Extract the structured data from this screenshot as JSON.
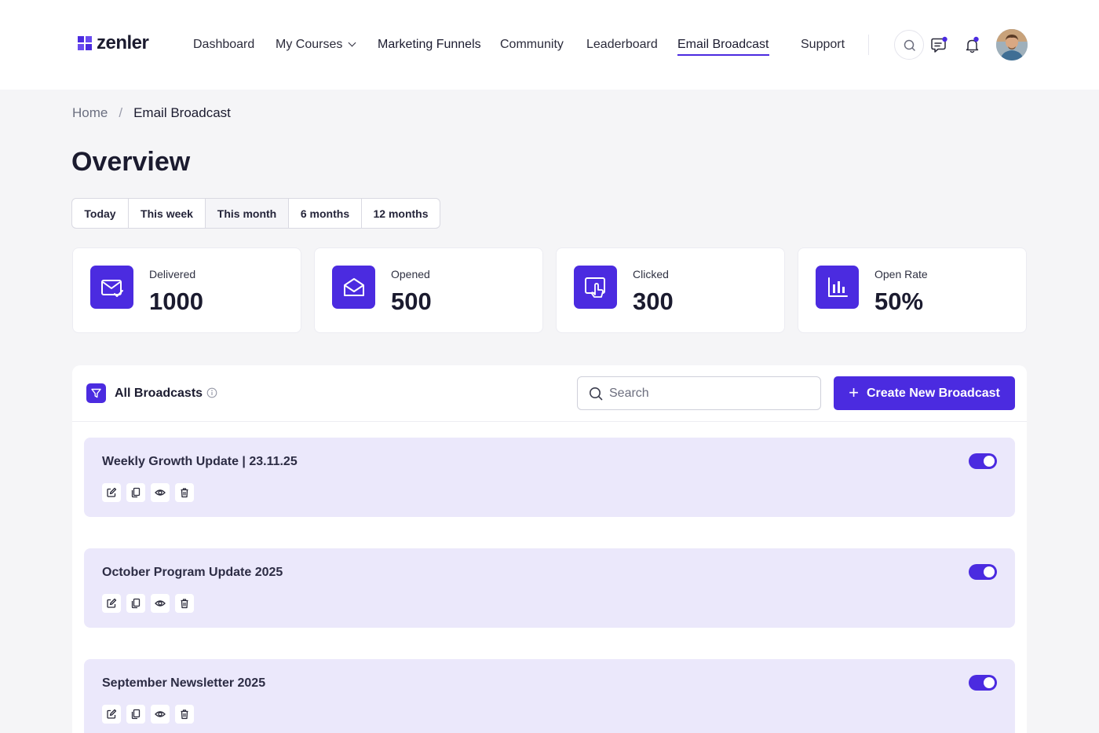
{
  "brand": {
    "name": "zenler",
    "accent": "#4b2be0"
  },
  "nav": {
    "items": [
      {
        "label": "Dashboard"
      },
      {
        "label": "My Courses"
      },
      {
        "label": "Marketing Funnels"
      },
      {
        "label": "Community"
      },
      {
        "label": "Leaderboard"
      },
      {
        "label": "Email Broadcast",
        "active": true
      },
      {
        "label": "Support"
      }
    ]
  },
  "header_icons": [
    "search-icon",
    "message-icon",
    "bell-icon",
    "avatar"
  ],
  "breadcrumb": {
    "home": "Home",
    "separator": "/",
    "current": "Email Broadcast"
  },
  "page": {
    "title": "Overview"
  },
  "ranges": {
    "items": [
      "Today",
      "This week",
      "This month",
      "6 months",
      "12 months"
    ],
    "selected": "This month"
  },
  "stats": [
    {
      "label": "Delivered",
      "value": "1000",
      "icon": "mail-check-icon"
    },
    {
      "label": "Opened",
      "value": "500",
      "icon": "mail-open-icon"
    },
    {
      "label": "Clicked",
      "value": "300",
      "icon": "click-icon"
    },
    {
      "label": "Open Rate",
      "value": "50%",
      "icon": "bar-chart-icon"
    }
  ],
  "broadcasts": {
    "title": "All Broadcasts",
    "search_placeholder": "Search",
    "create_label": "Create New Broadcast",
    "items": [
      {
        "title": "Weekly Growth Update | 23.11.25",
        "enabled": true
      },
      {
        "title": "October Program Update 2025",
        "enabled": true
      },
      {
        "title": "September Newsletter 2025",
        "enabled": true
      }
    ],
    "actions": [
      "edit-icon",
      "duplicate-icon",
      "preview-icon",
      "delete-icon"
    ]
  }
}
